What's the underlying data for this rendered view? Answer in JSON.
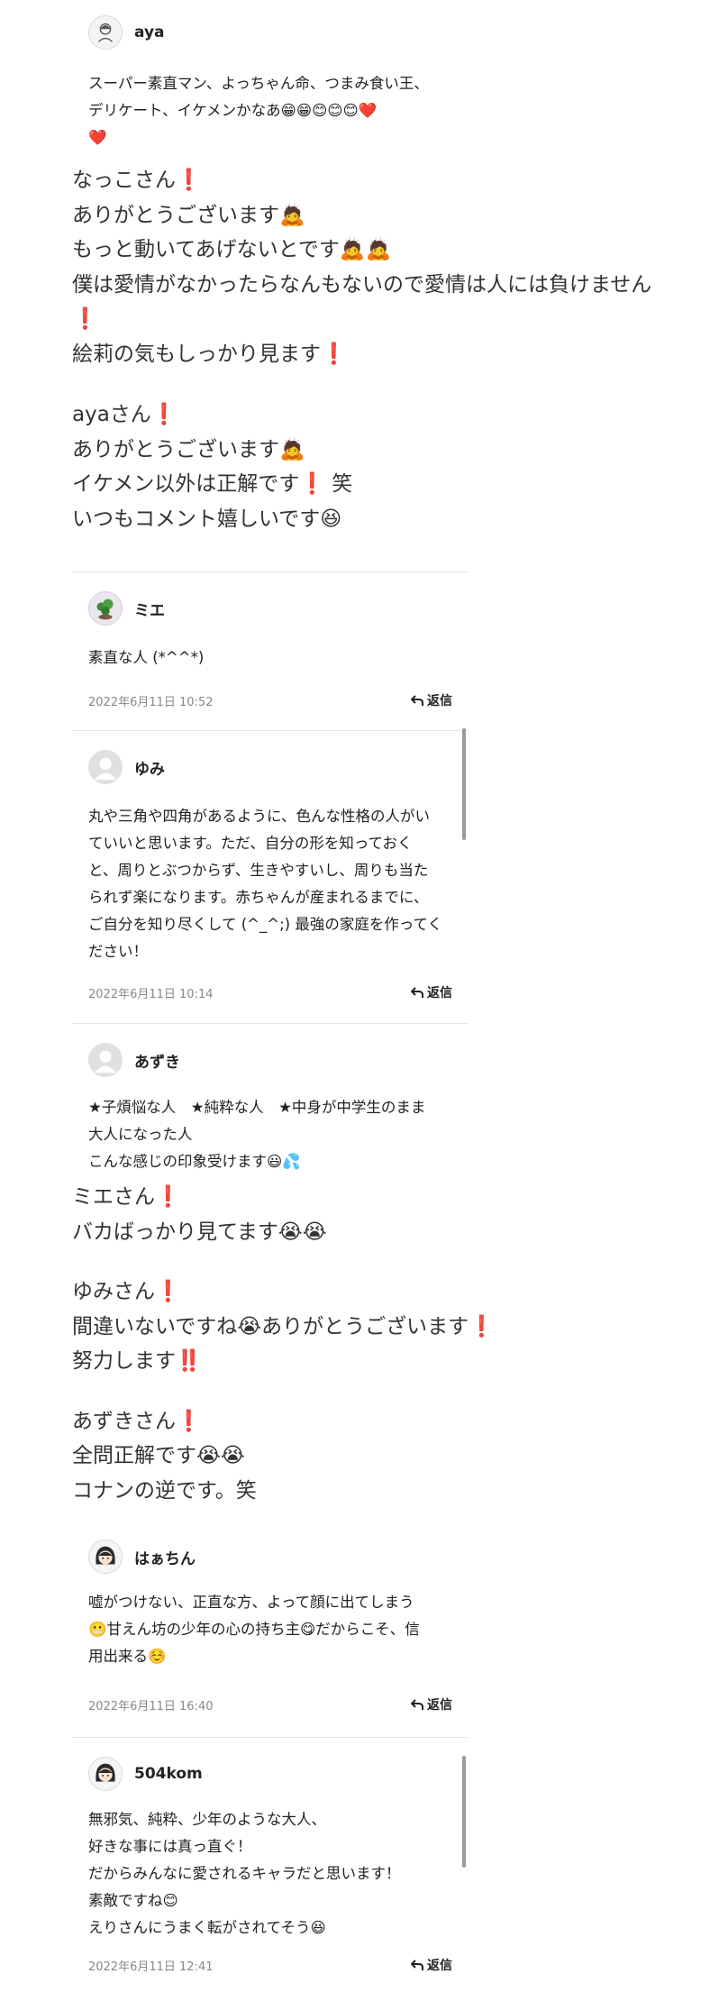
{
  "comments": {
    "aya": {
      "username": "aya",
      "avatar_label": "No Image",
      "text_line1": "スーパー素直マン、よっちゃん命、つまみ食い王、",
      "text_line2": "デリケート、イケメンかなあ😁😁😊😊😊❤️",
      "text_line3": "❤️"
    },
    "mie": {
      "username": "ミエ",
      "text": "素直な人 (*^^*)",
      "date": "2022年6月11日 10:52",
      "reply_label": "返信"
    },
    "yumi": {
      "username": "ゆみ",
      "lines": [
        "丸や三角や四角があるように、色んな性格の人がい",
        "ていいと思います。ただ、自分の形を知っておく",
        "と、周りとぶつからず、生きやすいし、周りも当た",
        "られず楽になります。赤ちゃんが産まれるまでに、",
        "ご自分を知り尽くして (^_^;) 最強の家庭を作ってく",
        "ださい！"
      ],
      "date": "2022年6月11日 10:14",
      "reply_label": "返信"
    },
    "azuki": {
      "username": "あずき",
      "lines": [
        "★子煩悩な人　★純粋な人　★中身が中学生のまま",
        "大人になった人",
        "こんな感じの印象受けます😃💦"
      ]
    },
    "haachin": {
      "username": "はぁちん",
      "lines": [
        "嘘がつけない、正直な方、よって顔に出てしまう",
        "😬甘えん坊の少年の心の持ち主😋だからこそ、信",
        "用出来る☺️"
      ],
      "date": "2022年6月11日 16:40",
      "reply_label": "返信"
    },
    "kom504": {
      "username": "504kom",
      "lines": [
        "無邪気、純粋、少年のような大人、",
        "好きな事には真っ直ぐ！",
        "だからみんなに愛されるキャラだと思います！",
        "素敵ですね😊",
        "えりさんにうまく転がされてそう😆"
      ],
      "date": "2022年6月11日 12:41",
      "reply_label": "返信"
    }
  },
  "replies": {
    "to_nakko": {
      "l1": "なっこさん",
      "l2": "ありがとうございます🙇",
      "l3": "もっと動いてあげないとです🙇🙇",
      "l4": "僕は愛情がなかったらなんもないので愛情は人には負けません",
      "l6": "絵莉の気もしっかり見ます"
    },
    "to_aya": {
      "l1": "ayaさん",
      "l2": "ありがとうございます🙇",
      "l3a": "イケメン以外は正解です",
      "l3b": "笑",
      "l4": "いつもコメント嬉しいです😆"
    },
    "to_mie_yumi_azuki": {
      "mie_l1": "ミエさん",
      "mie_l2": "バカばっかり見てます😭😭",
      "yumi_l1": "ゆみさん",
      "yumi_l2": "間違いないですね😭ありがとうございます",
      "yumi_l3": "努力します",
      "azuki_l1": "あずきさん",
      "azuki_l2": "全問正解です😭😭",
      "azuki_l3": "コナンの逆です。笑"
    }
  },
  "marks": {
    "exclamation": "❗",
    "double_exclamation": "‼️"
  },
  "colors": {
    "accent_red": "#d6202a",
    "divider": "#e6e6e6",
    "meta_gray": "#888888"
  }
}
